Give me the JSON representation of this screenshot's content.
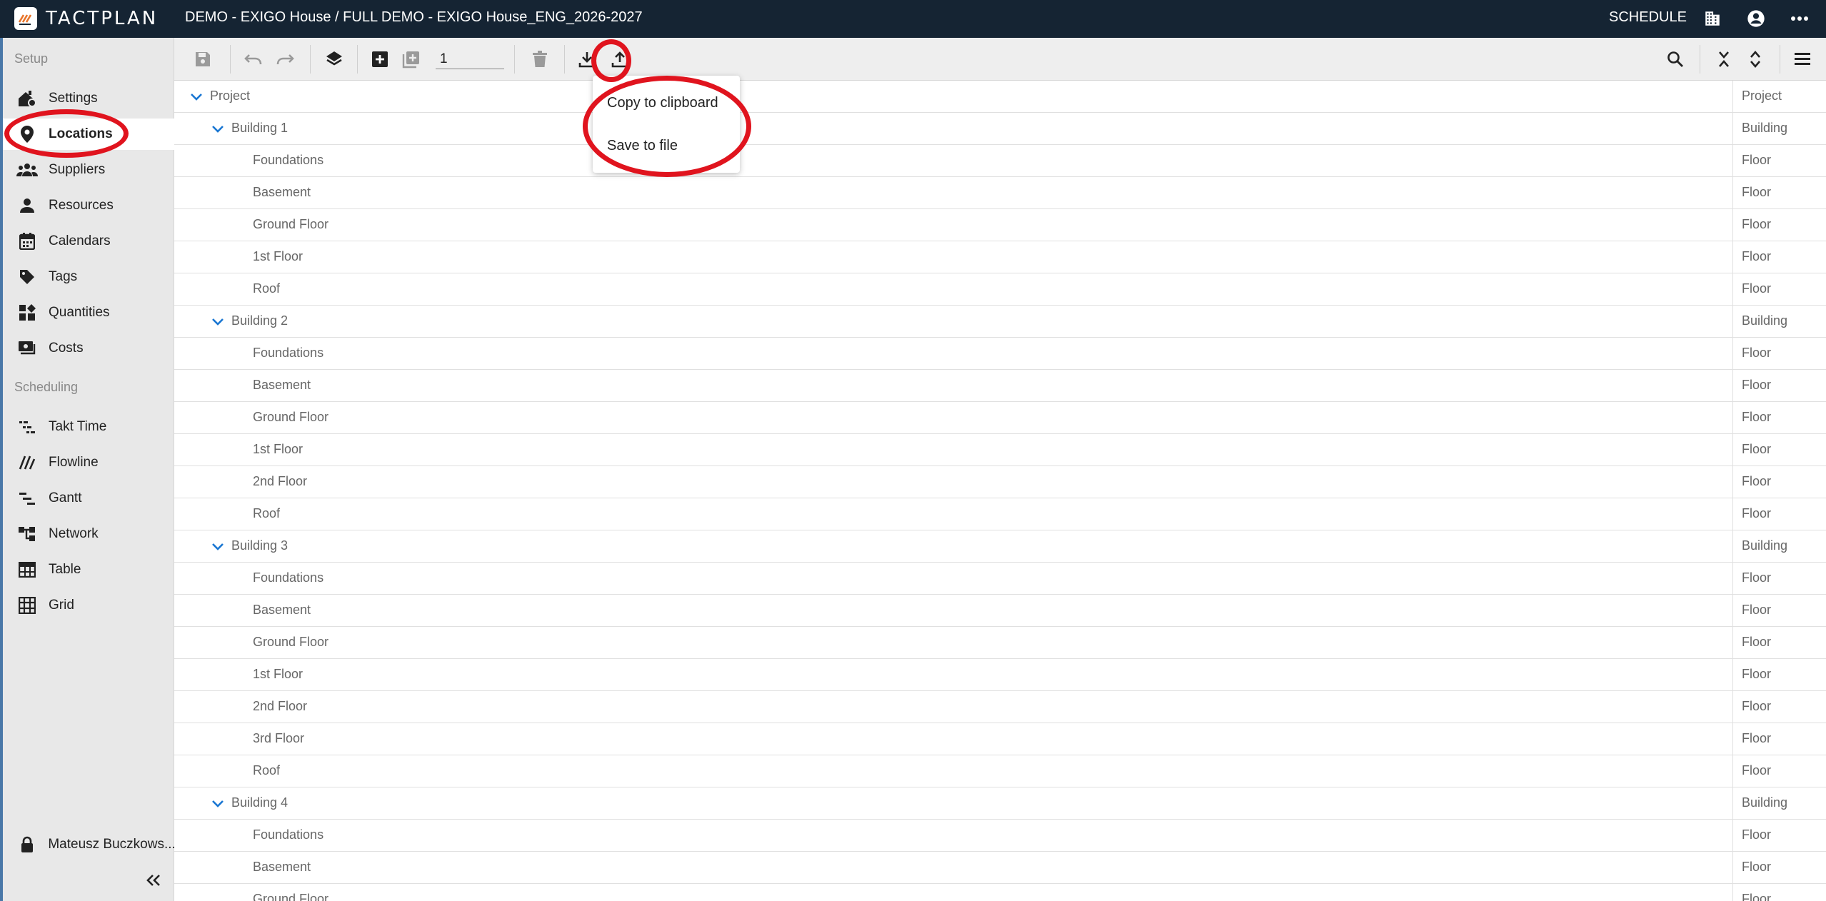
{
  "app": {
    "logo_text": "TACTPLAN"
  },
  "header": {
    "breadcrumb": "DEMO - EXIGO House / FULL DEMO - EXIGO House_ENG_2026-2027",
    "schedule_label": "SCHEDULE",
    "icons": [
      "building-icon",
      "account-icon",
      "more-icon"
    ]
  },
  "sidebar": {
    "setup_label": "Setup",
    "setup_items": [
      {
        "label": "Settings",
        "icon": "home-settings-icon"
      },
      {
        "label": "Locations",
        "icon": "location-pin-icon",
        "active": true
      },
      {
        "label": "Suppliers",
        "icon": "group-icon"
      },
      {
        "label": "Resources",
        "icon": "person-icon"
      },
      {
        "label": "Calendars",
        "icon": "calendar-icon"
      },
      {
        "label": "Tags",
        "icon": "tag-icon"
      },
      {
        "label": "Quantities",
        "icon": "widgets-icon"
      },
      {
        "label": "Costs",
        "icon": "money-icon"
      }
    ],
    "scheduling_label": "Scheduling",
    "scheduling_items": [
      {
        "label": "Takt Time",
        "icon": "takt-icon"
      },
      {
        "label": "Flowline",
        "icon": "flowline-icon"
      },
      {
        "label": "Gantt",
        "icon": "gantt-icon"
      },
      {
        "label": "Network",
        "icon": "network-icon"
      },
      {
        "label": "Table",
        "icon": "table-icon"
      },
      {
        "label": "Grid",
        "icon": "grid-icon"
      }
    ],
    "user_name": "Mateusz Buczkows...",
    "collapse_icon": "double-chevron-left-icon"
  },
  "toolbar": {
    "quantity_value": "1",
    "icons": [
      "save-icon",
      "undo-icon",
      "redo-icon",
      "layers-icon",
      "add-icon",
      "add-copy-icon",
      "delete-icon",
      "download-icon",
      "upload-icon",
      "search-icon",
      "collapse-all-icon",
      "expand-all-icon",
      "menu-icon"
    ]
  },
  "export_menu": {
    "items": [
      "Copy to clipboard",
      "Save to file"
    ]
  },
  "tree": {
    "type_header": "Project",
    "rows": [
      {
        "name": "Project",
        "type": "Project"
      },
      {
        "name": "Building 1",
        "type": "Building"
      },
      {
        "name": "Foundations",
        "type": "Floor"
      },
      {
        "name": "Basement",
        "type": "Floor"
      },
      {
        "name": "Ground Floor",
        "type": "Floor"
      },
      {
        "name": "1st Floor",
        "type": "Floor"
      },
      {
        "name": "Roof",
        "type": "Floor"
      },
      {
        "name": "Building 2",
        "type": "Building"
      },
      {
        "name": "Foundations",
        "type": "Floor"
      },
      {
        "name": "Basement",
        "type": "Floor"
      },
      {
        "name": "Ground Floor",
        "type": "Floor"
      },
      {
        "name": "1st Floor",
        "type": "Floor"
      },
      {
        "name": "2nd Floor",
        "type": "Floor"
      },
      {
        "name": "Roof",
        "type": "Floor"
      },
      {
        "name": "Building 3",
        "type": "Building"
      },
      {
        "name": "Foundations",
        "type": "Floor"
      },
      {
        "name": "Basement",
        "type": "Floor"
      },
      {
        "name": "Ground Floor",
        "type": "Floor"
      },
      {
        "name": "1st Floor",
        "type": "Floor"
      },
      {
        "name": "2nd Floor",
        "type": "Floor"
      },
      {
        "name": "3rd Floor",
        "type": "Floor"
      },
      {
        "name": "Roof",
        "type": "Floor"
      },
      {
        "name": "Building 4",
        "type": "Building"
      },
      {
        "name": "Foundations",
        "type": "Floor"
      },
      {
        "name": "Basement",
        "type": "Floor"
      },
      {
        "name": "Ground Floor",
        "type": "Floor"
      }
    ]
  },
  "colors": {
    "header_bg": "#152433",
    "accent": "#1976d2",
    "annotation_red": "#e0141e"
  }
}
